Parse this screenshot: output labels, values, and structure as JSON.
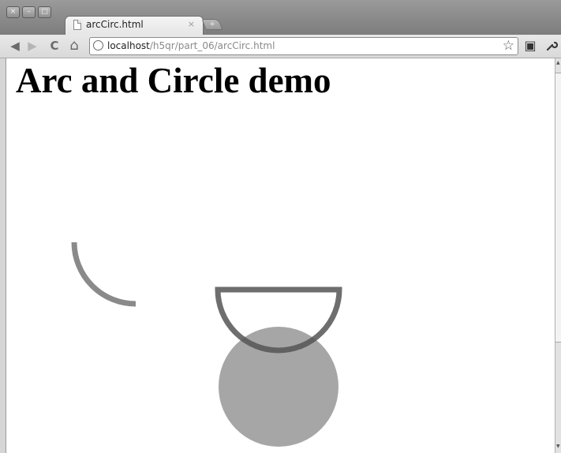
{
  "window": {
    "controls": {
      "close": "×",
      "minimize": "–",
      "maximize": "□"
    }
  },
  "tab": {
    "title": "arcCirc.html",
    "close": "×",
    "icon": "page-icon"
  },
  "new_tab": {
    "label": "+"
  },
  "toolbar": {
    "back_icon": "back-arrow-icon",
    "forward_icon": "forward-arrow-icon",
    "reload_icon": "reload-icon",
    "home_icon": "home-icon",
    "bookmark_icon": "star-icon",
    "extension_icon": "extension-icon",
    "wrench_icon": "wrench-icon",
    "glyphs": {
      "back": "◀",
      "forward": "▶",
      "reload": "C",
      "home": "⌂",
      "star": "☆",
      "ext": "▣",
      "wrench": "🔧"
    }
  },
  "address": {
    "host": "localhost",
    "path": "/h5qr/part_06/arcCirc.html"
  },
  "page": {
    "heading": "Arc and Circle demo"
  },
  "drawing": {
    "arc_color": "#8a8a8a",
    "semicircle_color": "#555555",
    "circle_color": "#a6a6a6"
  }
}
